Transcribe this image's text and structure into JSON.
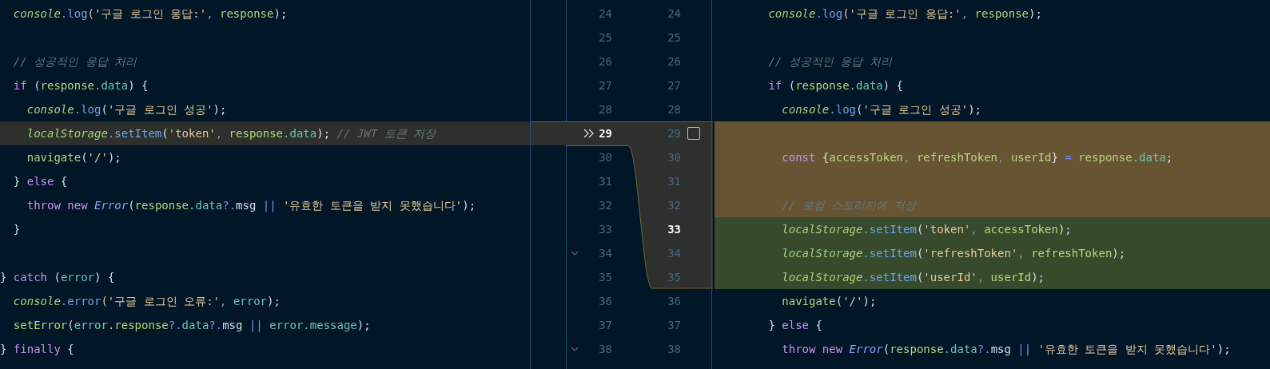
{
  "left_pane": {
    "lines": [
      {
        "kind": "plain",
        "tokens": [
          {
            "text": "  console",
            "kind": "obj"
          },
          {
            "text": ".log",
            "kind": "fn"
          },
          {
            "text": "('구글 로그인 응답:'",
            "kind": "str"
          },
          {
            "text": ", ",
            "kind": "dim"
          },
          {
            "text": "response",
            "kind": "var"
          },
          {
            "text": ");",
            "kind": "punc"
          }
        ]
      },
      {
        "kind": "plain"
      },
      {
        "kind": "plain",
        "tokens": [
          {
            "text": "  // 성공적인 응답 처리",
            "kind": "comment"
          }
        ]
      },
      {
        "kind": "plain",
        "tokens": [
          {
            "text": "  if",
            "kind": "kw"
          },
          {
            "text": " (",
            "kind": "punc"
          },
          {
            "text": "response",
            "kind": "var"
          },
          {
            "text": ".data",
            "kind": "prop"
          },
          {
            "text": ") {",
            "kind": "punc"
          }
        ]
      },
      {
        "kind": "plain",
        "tokens": [
          {
            "text": "    console",
            "kind": "obj"
          },
          {
            "text": ".log",
            "kind": "fn"
          },
          {
            "text": "(",
            "kind": "punc"
          },
          {
            "text": "'구글 로그인 성공'",
            "kind": "str"
          },
          {
            "text": ");",
            "kind": "punc"
          }
        ]
      },
      {
        "kind": "modified",
        "tokens": [
          {
            "text": "    localStorage",
            "kind": "obj"
          },
          {
            "text": ".setItem",
            "kind": "fn"
          },
          {
            "text": "(",
            "kind": "punc"
          },
          {
            "text": "'token'",
            "kind": "str"
          },
          {
            "text": ", ",
            "kind": "dim"
          },
          {
            "text": "response",
            "kind": "var"
          },
          {
            "text": ".data",
            "kind": "prop"
          },
          {
            "text": "); ",
            "kind": "punc"
          },
          {
            "text": "// JWT 토큰 저장",
            "kind": "comment"
          }
        ]
      },
      {
        "kind": "plain",
        "tokens": [
          {
            "text": "    navigate",
            "kind": "var"
          },
          {
            "text": "(",
            "kind": "punc"
          },
          {
            "text": "'/'",
            "kind": "str"
          },
          {
            "text": ");",
            "kind": "punc"
          }
        ]
      },
      {
        "kind": "plain",
        "tokens": [
          {
            "text": "  } ",
            "kind": "punc"
          },
          {
            "text": "else",
            "kind": "kw"
          },
          {
            "text": " {",
            "kind": "punc"
          }
        ]
      },
      {
        "kind": "plain",
        "tokens": [
          {
            "text": "    throw new ",
            "kind": "kw"
          },
          {
            "text": "Error",
            "kind": "type"
          },
          {
            "text": "(",
            "kind": "punc"
          },
          {
            "text": "response",
            "kind": "var"
          },
          {
            "text": ".data",
            "kind": "prop"
          },
          {
            "text": "?.",
            "kind": "op"
          },
          {
            "text": "msg ",
            "kind": "punc"
          },
          {
            "text": "||",
            "kind": "op"
          },
          {
            "text": " '유효한 토큰을 받지 못했습니다'",
            "kind": "str"
          },
          {
            "text": ");",
            "kind": "punc"
          }
        ]
      },
      {
        "kind": "plain",
        "tokens": [
          {
            "text": "  }",
            "kind": "punc"
          }
        ]
      },
      {
        "kind": "plain"
      },
      {
        "kind": "plain",
        "tokens": [
          {
            "text": "} ",
            "kind": "punc"
          },
          {
            "text": "catch",
            "kind": "kw"
          },
          {
            "text": " (",
            "kind": "punc"
          },
          {
            "text": "error",
            "kind": "prop"
          },
          {
            "text": ") {",
            "kind": "punc"
          }
        ]
      },
      {
        "kind": "plain",
        "tokens": [
          {
            "text": "  console",
            "kind": "obj"
          },
          {
            "text": ".error",
            "kind": "fn"
          },
          {
            "text": "('구글 로그인 오류:'",
            "kind": "str"
          },
          {
            "text": ", ",
            "kind": "dim"
          },
          {
            "text": "error",
            "kind": "prop"
          },
          {
            "text": ");",
            "kind": "punc"
          }
        ]
      },
      {
        "kind": "plain",
        "tokens": [
          {
            "text": "  setError",
            "kind": "var"
          },
          {
            "text": "(",
            "kind": "punc"
          },
          {
            "text": "error",
            "kind": "prop"
          },
          {
            "text": ".response",
            "kind": "var"
          },
          {
            "text": "?.",
            "kind": "op"
          },
          {
            "text": "data",
            "kind": "prop"
          },
          {
            "text": "?.",
            "kind": "op"
          },
          {
            "text": "msg ",
            "kind": "punc"
          },
          {
            "text": "|| ",
            "kind": "op"
          },
          {
            "text": "error",
            "kind": "prop"
          },
          {
            "text": ".message",
            "kind": "prop"
          },
          {
            "text": ");",
            "kind": "punc"
          }
        ]
      },
      {
        "kind": "plain",
        "tokens": [
          {
            "text": "} ",
            "kind": "punc"
          },
          {
            "text": "finally",
            "kind": "kw"
          },
          {
            "text": " {",
            "kind": "punc"
          }
        ]
      }
    ]
  },
  "gutter": {
    "rows": [
      {
        "left_number": "24",
        "right_number": "24",
        "left_current": false,
        "right_current": false,
        "apply_arrow": false,
        "fold": false
      },
      {
        "left_number": "25",
        "right_number": "25",
        "left_current": false,
        "right_current": false,
        "apply_arrow": false,
        "fold": false
      },
      {
        "left_number": "26",
        "right_number": "26",
        "left_current": false,
        "right_current": false,
        "apply_arrow": false,
        "fold": false
      },
      {
        "left_number": "27",
        "right_number": "27",
        "left_current": false,
        "right_current": false,
        "apply_arrow": false,
        "fold": false
      },
      {
        "left_number": "28",
        "right_number": "28",
        "left_current": false,
        "right_current": false,
        "apply_arrow": false,
        "fold": false
      },
      {
        "left_number": "29",
        "right_number": "29",
        "left_current": true,
        "right_current": false,
        "apply_arrow": true,
        "fold": false,
        "checkbox": {
          "checked": false
        }
      },
      {
        "left_number": "30",
        "right_number": "30",
        "left_current": false,
        "right_current": false,
        "apply_arrow": false,
        "fold": false
      },
      {
        "left_number": "31",
        "right_number": "31",
        "left_current": false,
        "right_current": false,
        "apply_arrow": false,
        "fold": false
      },
      {
        "left_number": "32",
        "right_number": "32",
        "left_current": false,
        "right_current": false,
        "apply_arrow": false,
        "fold": false
      },
      {
        "left_number": "33",
        "right_number": "33",
        "left_current": false,
        "right_current": true,
        "apply_arrow": false,
        "fold": false
      },
      {
        "left_number": "34",
        "right_number": "34",
        "left_current": false,
        "right_current": false,
        "apply_arrow": false,
        "fold": true
      },
      {
        "left_number": "35",
        "right_number": "35",
        "left_current": false,
        "right_current": false,
        "apply_arrow": false,
        "fold": false
      },
      {
        "left_number": "36",
        "right_number": "36",
        "left_current": false,
        "right_current": false,
        "apply_arrow": false,
        "fold": false
      },
      {
        "left_number": "37",
        "right_number": "37",
        "left_current": false,
        "right_current": false,
        "apply_arrow": false,
        "fold": false
      },
      {
        "left_number": "38",
        "right_number": "38",
        "left_current": false,
        "right_current": false,
        "apply_arrow": false,
        "fold": true
      }
    ]
  },
  "right_pane": {
    "lines": [
      {
        "kind": "plain",
        "tokens": [
          {
            "text": "        console",
            "kind": "obj"
          },
          {
            "text": ".log",
            "kind": "fn"
          },
          {
            "text": "('구글 로그인 응답:'",
            "kind": "str"
          },
          {
            "text": ", ",
            "kind": "dim"
          },
          {
            "text": "response",
            "kind": "var"
          },
          {
            "text": ");",
            "kind": "punc"
          }
        ]
      },
      {
        "kind": "plain"
      },
      {
        "kind": "plain",
        "tokens": [
          {
            "text": "        // 성공적인 응답 처리",
            "kind": "comment"
          }
        ]
      },
      {
        "kind": "plain",
        "tokens": [
          {
            "text": "        if",
            "kind": "kw"
          },
          {
            "text": " (",
            "kind": "punc"
          },
          {
            "text": "response",
            "kind": "var"
          },
          {
            "text": ".data",
            "kind": "prop"
          },
          {
            "text": ") {",
            "kind": "punc"
          }
        ]
      },
      {
        "kind": "plain",
        "tokens": [
          {
            "text": "          console",
            "kind": "obj"
          },
          {
            "text": ".log",
            "kind": "fn"
          },
          {
            "text": "(",
            "kind": "punc"
          },
          {
            "text": "'구글 로그인 성공'",
            "kind": "str"
          },
          {
            "text": ");",
            "kind": "punc"
          }
        ]
      },
      {
        "kind": "modified"
      },
      {
        "kind": "modified",
        "tokens": [
          {
            "text": "          const",
            "kind": "kw"
          },
          {
            "text": " {",
            "kind": "punc"
          },
          {
            "text": "accessToken",
            "kind": "var"
          },
          {
            "text": ", ",
            "kind": "dim"
          },
          {
            "text": "refreshToken",
            "kind": "var"
          },
          {
            "text": ", ",
            "kind": "dim"
          },
          {
            "text": "userId",
            "kind": "var"
          },
          {
            "text": "} ",
            "kind": "punc"
          },
          {
            "text": "= ",
            "kind": "op"
          },
          {
            "text": "response",
            "kind": "var"
          },
          {
            "text": ".data",
            "kind": "prop"
          },
          {
            "text": ";",
            "kind": "punc"
          }
        ]
      },
      {
        "kind": "modified"
      },
      {
        "kind": "modified",
        "tokens": [
          {
            "text": "          // 로컬 스토리지에 저장",
            "kind": "comment"
          }
        ]
      },
      {
        "kind": "added",
        "tokens": [
          {
            "text": "          localStorage",
            "kind": "obj"
          },
          {
            "text": ".setItem",
            "kind": "fn"
          },
          {
            "text": "(",
            "kind": "punc"
          },
          {
            "text": "'token'",
            "kind": "str"
          },
          {
            "text": ", ",
            "kind": "dim"
          },
          {
            "text": "accessToken",
            "kind": "var"
          },
          {
            "text": ");",
            "kind": "punc"
          }
        ]
      },
      {
        "kind": "added",
        "tokens": [
          {
            "text": "          localStorage",
            "kind": "obj"
          },
          {
            "text": ".setItem",
            "kind": "fn"
          },
          {
            "text": "(",
            "kind": "punc"
          },
          {
            "text": "'refreshToken'",
            "kind": "str"
          },
          {
            "text": ", ",
            "kind": "dim"
          },
          {
            "text": "refreshToken",
            "kind": "var"
          },
          {
            "text": ");",
            "kind": "punc"
          }
        ]
      },
      {
        "kind": "added",
        "tokens": [
          {
            "text": "          localStorage",
            "kind": "obj"
          },
          {
            "text": ".setItem",
            "kind": "fn"
          },
          {
            "text": "(",
            "kind": "punc"
          },
          {
            "text": "'userId'",
            "kind": "str"
          },
          {
            "text": ", ",
            "kind": "dim"
          },
          {
            "text": "userId",
            "kind": "var"
          },
          {
            "text": ");",
            "kind": "punc"
          }
        ]
      },
      {
        "kind": "plain",
        "tokens": [
          {
            "text": "          navigate",
            "kind": "var"
          },
          {
            "text": "(",
            "kind": "punc"
          },
          {
            "text": "'/'",
            "kind": "str"
          },
          {
            "text": ");",
            "kind": "punc"
          }
        ]
      },
      {
        "kind": "plain",
        "tokens": [
          {
            "text": "        } ",
            "kind": "punc"
          },
          {
            "text": "else",
            "kind": "kw"
          },
          {
            "text": " {",
            "kind": "punc"
          }
        ]
      },
      {
        "kind": "plain",
        "tokens": [
          {
            "text": "          throw new ",
            "kind": "kw"
          },
          {
            "text": "Error",
            "kind": "type"
          },
          {
            "text": "(",
            "kind": "punc"
          },
          {
            "text": "response",
            "kind": "var"
          },
          {
            "text": ".data",
            "kind": "prop"
          },
          {
            "text": "?.",
            "kind": "op"
          },
          {
            "text": "msg ",
            "kind": "punc"
          },
          {
            "text": "||",
            "kind": "op"
          },
          {
            "text": " '유효한 토큰을 받지 못했습니다'",
            "kind": "str"
          },
          {
            "text": ");",
            "kind": "punc"
          }
        ]
      }
    ]
  }
}
